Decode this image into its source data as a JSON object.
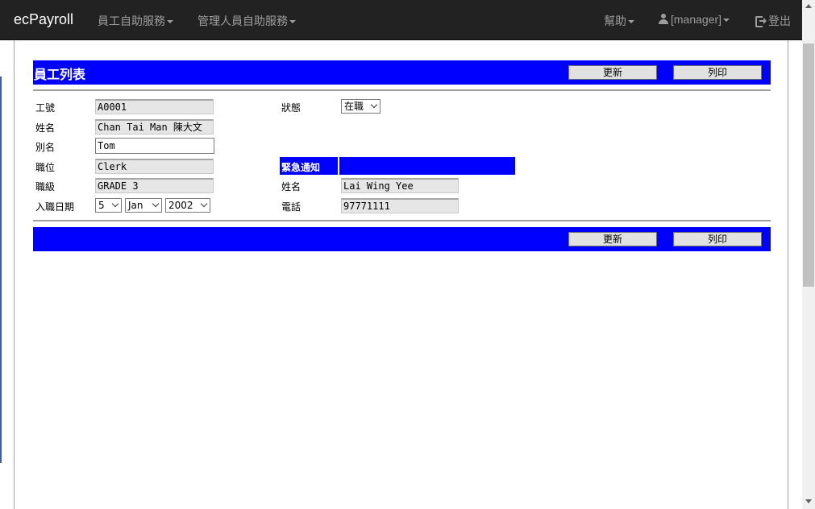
{
  "navbar": {
    "brand": "ecPayroll",
    "menu_employee": "員工自助服務",
    "menu_manager": "管理人員自助服務",
    "help": "幫助",
    "user": "[manager]",
    "logout": "登出"
  },
  "page": {
    "title": "員工列表",
    "update_label": "更新",
    "print_label": "列印"
  },
  "form": {
    "employee_id": {
      "label": "工號",
      "value": "A0001"
    },
    "name": {
      "label": "姓名",
      "value": "Chan Tai Man 陳大文"
    },
    "alias": {
      "label": "別名",
      "value": "Tom"
    },
    "position": {
      "label": "職位",
      "value": "Clerk"
    },
    "grade": {
      "label": "職級",
      "value": "GRADE 3"
    },
    "join_date": {
      "label": "入職日期",
      "day": "5",
      "month": "Jan",
      "year": "2002"
    },
    "status": {
      "label": "狀態",
      "value": "在職"
    }
  },
  "emergency": {
    "title": "緊急通知",
    "name": {
      "label": "姓名",
      "value": "Lai Wing Yee"
    },
    "phone": {
      "label": "電話",
      "value": "97771111"
    }
  }
}
